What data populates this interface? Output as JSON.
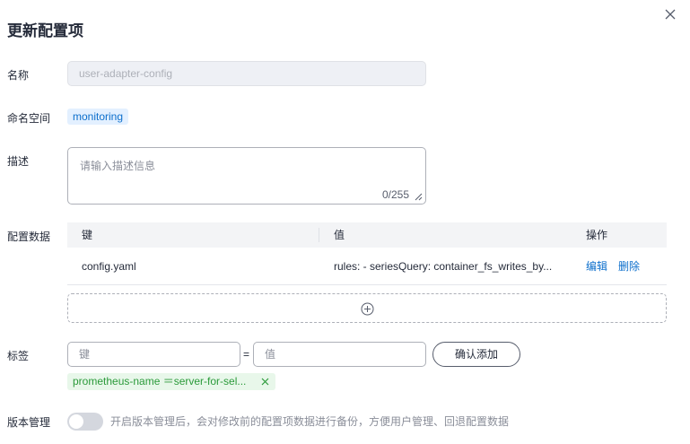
{
  "dialog": {
    "title": "更新配置项"
  },
  "fields": {
    "name": {
      "label": "名称",
      "value": "user-adapter-config"
    },
    "namespace": {
      "label": "命名空间",
      "value": "monitoring"
    },
    "description": {
      "label": "描述",
      "placeholder": "请输入描述信息",
      "counter": "0/255"
    },
    "config_data": {
      "label": "配置数据",
      "columns": [
        "键",
        "值",
        "操作"
      ],
      "rows": [
        {
          "key": "config.yaml",
          "value": "rules: - seriesQuery: container_fs_writes_by...",
          "actions": [
            "编辑",
            "删除"
          ]
        }
      ]
    },
    "labels": {
      "label": "标签",
      "key_placeholder": "键",
      "equals": "=",
      "value_placeholder": "值",
      "confirm_button": "确认添加",
      "tags": [
        {
          "text": "prometheus-name ＝server-for-sel..."
        }
      ]
    },
    "version": {
      "label": "版本管理",
      "enabled": false,
      "hint": "开启版本管理后，会对修改前的配置项数据进行备份，方便用户管理、回退配置数据"
    }
  },
  "colors": {
    "accent": "#0d6fcc",
    "tag_bg": "#e3f0ff",
    "label_tag_text": "#2b9a3a",
    "label_tag_bg": "#e8f7ea"
  },
  "icons": {
    "close": "close-icon",
    "add": "plus-circle-icon",
    "tag_close": "close-icon",
    "resize": "resize-handle-icon"
  }
}
